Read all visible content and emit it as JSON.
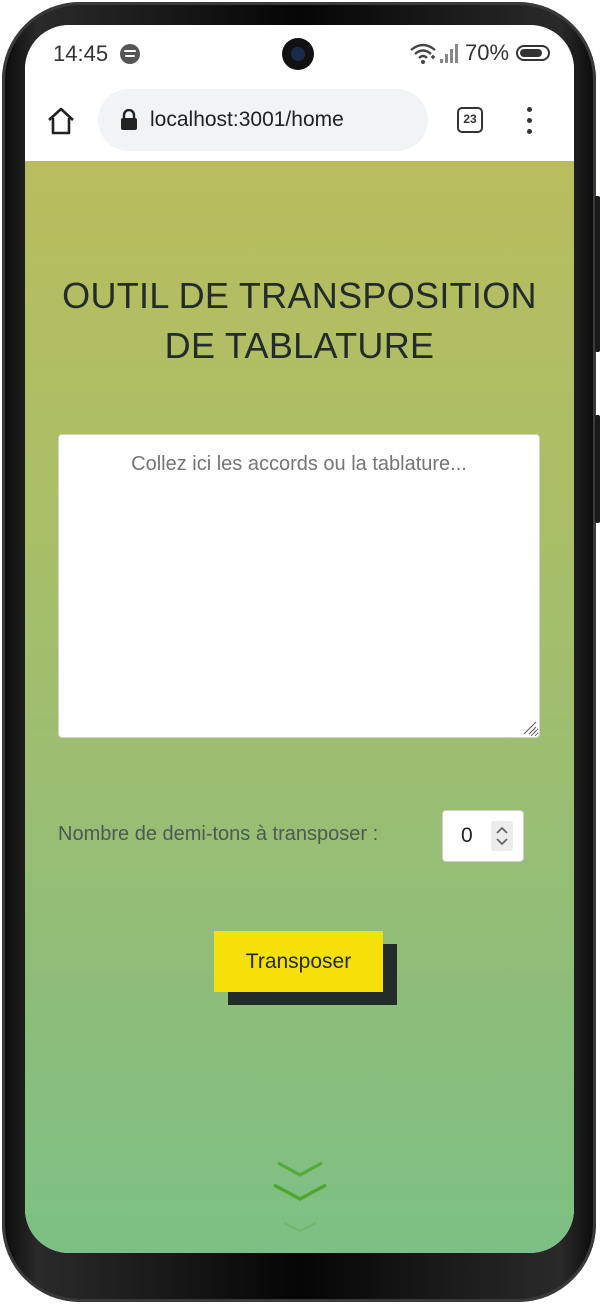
{
  "status_bar": {
    "time": "14:45",
    "battery": "70%"
  },
  "browser": {
    "url": "localhost:3001/home",
    "tab_count": "23"
  },
  "main": {
    "title": "OUTIL DE TRANSPOSITION DE TABLATURE",
    "textarea_placeholder": "Collez ici les accords ou la tablature...",
    "semitone_label": "Nombre de demi-tons à transposer :",
    "semitone_value": "0",
    "transpose_button": "Transposer"
  },
  "colors": {
    "accent_button": "#f5e009",
    "button_shadow": "#232b2b",
    "gradient_top": "#b9bd5e",
    "gradient_bottom": "#7cc085",
    "chevron": "#5aa83a"
  }
}
